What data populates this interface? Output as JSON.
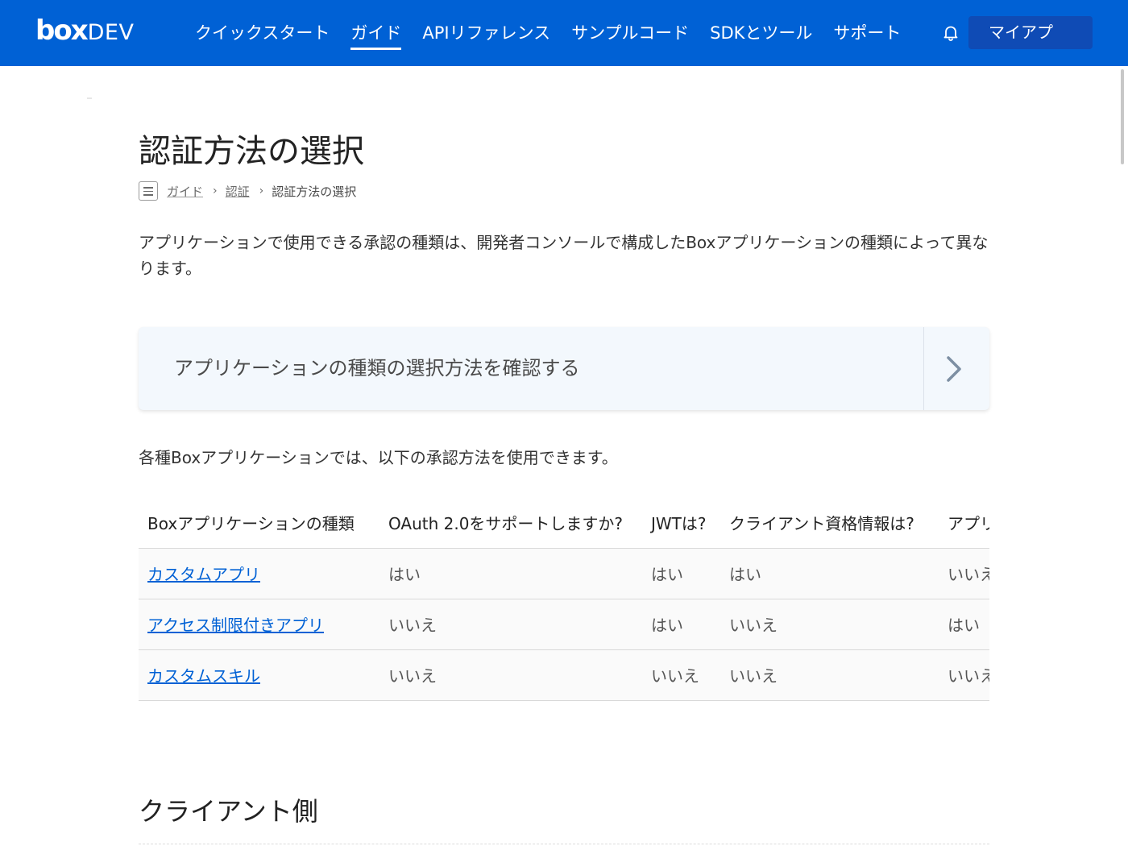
{
  "header": {
    "logo_box": "box",
    "logo_dev": "DEV",
    "nav": [
      {
        "label": "クイックスタート"
      },
      {
        "label": "ガイド"
      },
      {
        "label": "APIリファレンス"
      },
      {
        "label": "サンプルコード"
      },
      {
        "label": "SDKとツール"
      },
      {
        "label": "サポート"
      }
    ],
    "active_nav": "ガイド",
    "my_apps_label": "マイアプ",
    "colors": {
      "bar": "#0061d5",
      "button": "#0f4bb5"
    }
  },
  "page": {
    "title": "認証方法の選択",
    "breadcrumb": {
      "items": [
        "ガイド",
        "認証",
        "認証方法の選択"
      ],
      "separator": "›"
    },
    "intro": "アプリケーションで使用できる承認の種類は、開発者コンソールで構成したBoxアプリケーションの種類によって異なります。",
    "cta": {
      "label": "アプリケーションの種類の選択方法を確認する",
      "icon": "chevron-right-icon"
    },
    "sub_intro": "各種Boxアプリケーションでは、以下の承認方法を使用できます。",
    "table": {
      "headers": [
        "Boxアプリケーションの種類",
        "OAuth 2.0をサポートしますか?",
        "JWTは?",
        "クライアント資格情報は?",
        "アプリトークン認証は?"
      ],
      "rows": [
        {
          "app": "カスタムアプリ",
          "oauth": "はい",
          "jwt": "はい",
          "client_credentials": "はい",
          "app_token": "いいえ"
        },
        {
          "app": "アクセス制限付きアプリ",
          "oauth": "いいえ",
          "jwt": "はい",
          "client_credentials": "いいえ",
          "app_token": "はい"
        },
        {
          "app": "カスタムスキル",
          "oauth": "いいえ",
          "jwt": "いいえ",
          "client_credentials": "いいえ",
          "app_token": "いいえ"
        }
      ]
    },
    "section_title": "クライアント側"
  }
}
